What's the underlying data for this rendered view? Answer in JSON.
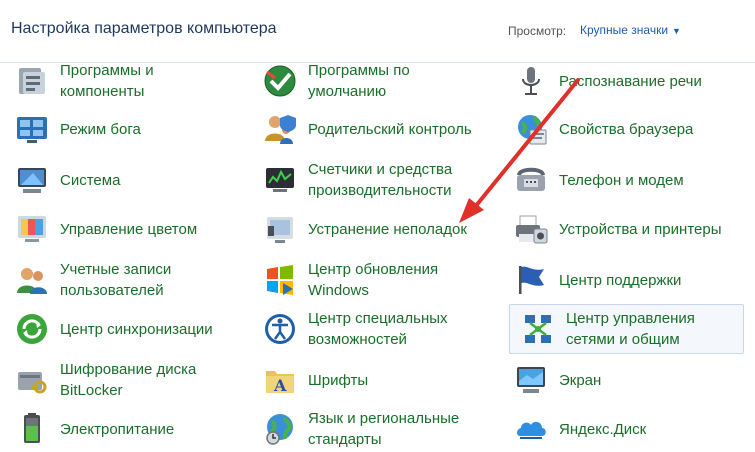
{
  "header": {
    "title": "Настройка параметров компьютера",
    "view_label": "Просмотр:",
    "view_value": "Крупные значки"
  },
  "items": [
    {
      "label": "Программы и\nкомпоненты",
      "icon": "programs-icon"
    },
    {
      "label": "Программы по\nумолчанию",
      "icon": "default-programs-icon"
    },
    {
      "label": "Распознавание речи",
      "icon": "microphone-icon"
    },
    {
      "label": "Режим бога",
      "icon": "god-mode-icon"
    },
    {
      "label": "Родительский контроль",
      "icon": "parental-control-icon"
    },
    {
      "label": "Свойства браузера",
      "icon": "browser-properties-icon"
    },
    {
      "label": "Система",
      "icon": "system-icon"
    },
    {
      "label": "Счетчики и средства\nпроизводительности",
      "icon": "performance-icon"
    },
    {
      "label": "Телефон и модем",
      "icon": "phone-modem-icon"
    },
    {
      "label": "Управление цветом",
      "icon": "color-management-icon"
    },
    {
      "label": "Устранение неполадок",
      "icon": "troubleshooting-icon"
    },
    {
      "label": "Устройства и принтеры",
      "icon": "printer-icon"
    },
    {
      "label": "Учетные записи\nпользователей",
      "icon": "user-accounts-icon"
    },
    {
      "label": "Центр обновления\nWindows",
      "icon": "windows-update-icon"
    },
    {
      "label": "Центр поддержки",
      "icon": "action-center-flag-icon"
    },
    {
      "label": "Центр синхронизации",
      "icon": "sync-center-icon"
    },
    {
      "label": "Центр специальных\nвозможностей",
      "icon": "accessibility-icon"
    },
    {
      "label": "Центр управления\nсетями и общим",
      "icon": "network-center-icon"
    },
    {
      "label": "Шифрование диска\nBitLocker",
      "icon": "bitlocker-icon"
    },
    {
      "label": "Шрифты",
      "icon": "fonts-icon"
    },
    {
      "label": "Экран",
      "icon": "display-icon"
    },
    {
      "label": "Электропитание",
      "icon": "power-options-icon"
    },
    {
      "label": "Язык и региональные\nстандарты",
      "icon": "language-region-icon"
    },
    {
      "label": "Яндекс.Диск",
      "icon": "yandex-disk-icon"
    }
  ],
  "annotation": {
    "color": "#e0302a",
    "target": "Устранение неполадок"
  }
}
